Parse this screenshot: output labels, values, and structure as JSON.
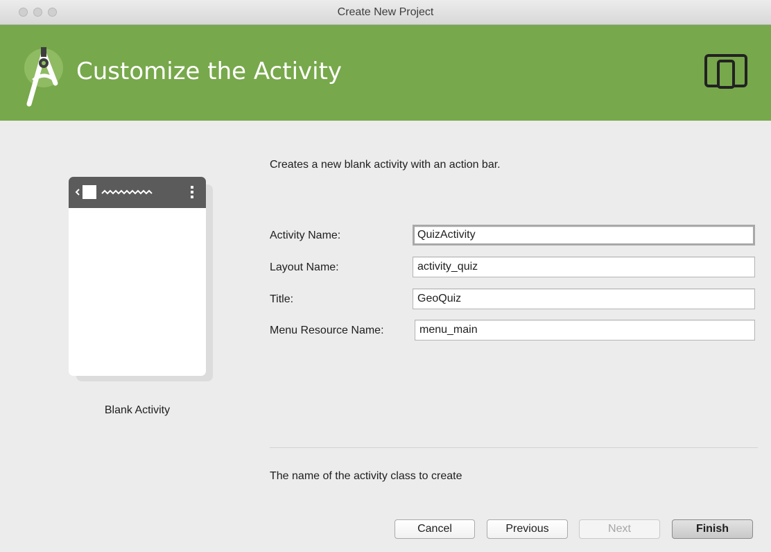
{
  "window": {
    "title": "Create New Project"
  },
  "header": {
    "title": "Customize the Activity",
    "logo_icon": "android-studio-icon",
    "device_icon": "phone-tablet-icon",
    "color": "#77a84b"
  },
  "preview": {
    "label": "Blank Activity"
  },
  "description": "Creates a new blank activity with an action bar.",
  "fields": [
    {
      "label": "Activity Name:",
      "value": "QuizActivity"
    },
    {
      "label": "Layout Name:",
      "value": "activity_quiz"
    },
    {
      "label": "Title:",
      "value": "GeoQuiz"
    },
    {
      "label": "Menu Resource Name:",
      "value": "menu_main"
    }
  ],
  "hint": "The name of the activity class to create",
  "buttons": {
    "cancel": "Cancel",
    "previous": "Previous",
    "next": "Next",
    "finish": "Finish"
  }
}
